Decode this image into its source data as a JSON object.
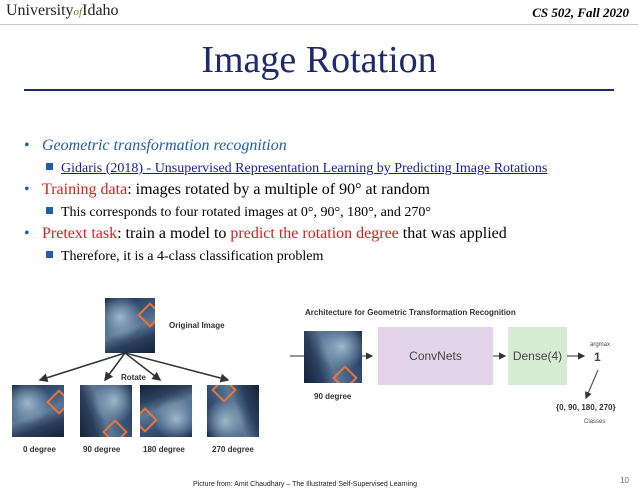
{
  "header": {
    "logo_left": "University",
    "logo_of": "of",
    "logo_right": "Idaho",
    "course": "CS 502, Fall 2020"
  },
  "slide": {
    "title": "Image Rotation",
    "bullets": [
      {
        "text": "Geometric transformation recognition"
      },
      {
        "link": "Gidaris (2018) - Unsupervised Representation Learning by Predicting Image Rotations"
      },
      {
        "lead": "Training data",
        "rest": ": images rotated by a multiple of 90° at random"
      },
      {
        "text": "This corresponds to four rotated images at 0°, 90°, 180°, and 270°"
      },
      {
        "lead": "Pretext task",
        "mid": ": train a model to ",
        "emph": "predict the rotation degree",
        "rest": " that was applied"
      },
      {
        "text": "Therefore, it is a 4-class classification problem"
      }
    ]
  },
  "left_figure": {
    "original_label": "Original Image",
    "rotate_label": "Rotate",
    "degree_labels": [
      "0 degree",
      "90 degree",
      "180 degree",
      "270 degree"
    ]
  },
  "right_figure": {
    "heading": "Architecture for Geometric Transformation Recognition",
    "input_label": "90 degree",
    "convnets_label": "ConvNets",
    "dense_label": "Dense(4)",
    "argmax_label": "argmax",
    "output_value": "1",
    "classes_set": "{0, 90, 180, 270}",
    "classes_label": "Classes",
    "colors": {
      "convnets": "#e3d4ea",
      "dense": "#d5ebd3"
    }
  },
  "footer": {
    "credit": "Picture from: Amit Chaudhary – The Illustrated Self-Supervised Learning",
    "page_number": "10"
  }
}
